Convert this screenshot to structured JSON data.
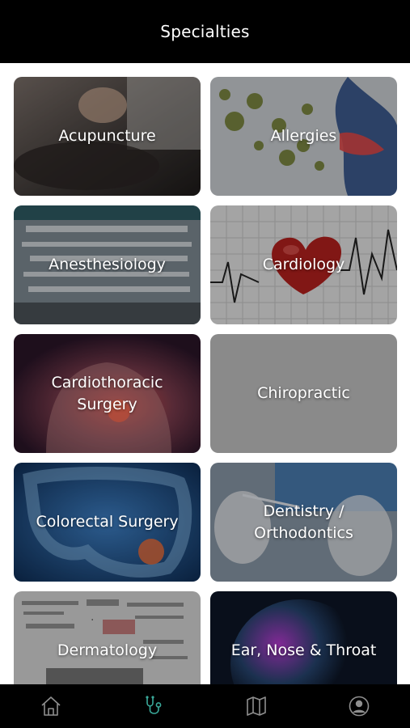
{
  "header": {
    "title": "Specialties"
  },
  "specialties": [
    {
      "label": "Acupuncture",
      "bg": "#5a5350",
      "icon": "acupuncture-image"
    },
    {
      "label": "Allergies",
      "bg": "#9aa1a8",
      "icon": "allergies-image"
    },
    {
      "label": "Anesthesiology",
      "bg": "#5e6a72",
      "icon": "anesthesiology-image"
    },
    {
      "label": "Cardiology",
      "bg": "#bfbfbf",
      "icon": "cardiology-image"
    },
    {
      "label": "Cardiothoracic\nSurgery",
      "bg": "#6b3c45",
      "icon": "cardiothoracic-image"
    },
    {
      "label": "Chiropractic",
      "bg": "#8a8a8a",
      "icon": ""
    },
    {
      "label": "Colorectal Surgery",
      "bg": "#1e4f86",
      "icon": "colorectal-image"
    },
    {
      "label": "Dentistry /\nOrthodontics",
      "bg": "#6f7f90",
      "icon": "dentistry-image"
    },
    {
      "label": "Dermatology",
      "bg": "#b7b7b7",
      "icon": "dermatology-image"
    },
    {
      "label": "Ear, Nose & Throat",
      "bg": "#172a44",
      "icon": "ent-image"
    }
  ],
  "tabbar": {
    "tabs": [
      {
        "name": "home",
        "icon": "home-icon",
        "active": false
      },
      {
        "name": "specialties",
        "icon": "stethoscope-icon",
        "active": true
      },
      {
        "name": "map",
        "icon": "map-icon",
        "active": false
      },
      {
        "name": "profile",
        "icon": "profile-icon",
        "active": false
      }
    ],
    "active_color": "#3aa99a",
    "inactive_color": "#8f8f8f"
  }
}
